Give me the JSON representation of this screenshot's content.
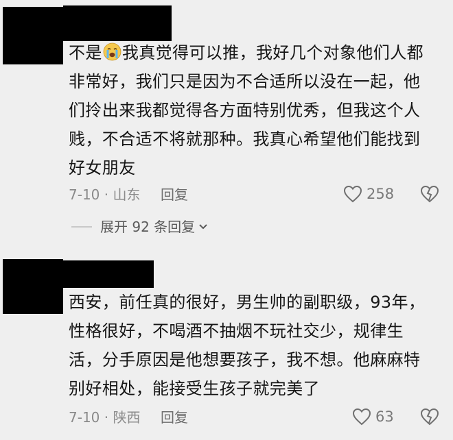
{
  "comments": [
    {
      "text_lines": [
        "不是",
        "我真觉得可以推，我好几个对象他们人都",
        "非常好，我们只是因为不合适所以没在一起，他",
        "们拎出来我都觉得各方面特别优秀，但我这个人",
        "贱，不合适不将就那种。我真心希望他们能找到",
        "好女朋友"
      ],
      "emoji": "crying-face-emoji",
      "date": "7-10",
      "location": "山东",
      "reply_label": "回复",
      "likes": "258"
    },
    {
      "text_lines": [
        "西安，前任真的很好，男生帅的副职级，93年，",
        "性格很好，不喝酒不抽烟不玩社交少，规律生",
        "活，分手原因是他想要孩子，我不想。他麻麻特",
        "别好相处，能接受生孩子就完美了"
      ],
      "date": "7-10",
      "location": "陕西",
      "reply_label": "回复",
      "likes": "63"
    }
  ],
  "expand_replies": {
    "label": "展开 92 条回复"
  },
  "colors": {
    "background": "#efefef",
    "text": "#161616",
    "meta": "#8a8a8a",
    "redaction": "#000000"
  }
}
